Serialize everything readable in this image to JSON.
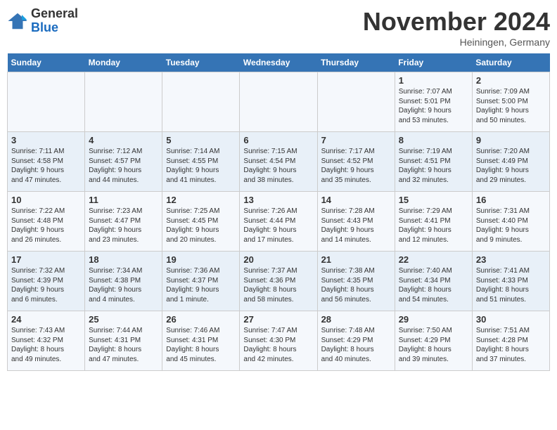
{
  "logo": {
    "general": "General",
    "blue": "Blue"
  },
  "title": "November 2024",
  "location": "Heiningen, Germany",
  "days_of_week": [
    "Sunday",
    "Monday",
    "Tuesday",
    "Wednesday",
    "Thursday",
    "Friday",
    "Saturday"
  ],
  "weeks": [
    [
      {
        "day": "",
        "info": ""
      },
      {
        "day": "",
        "info": ""
      },
      {
        "day": "",
        "info": ""
      },
      {
        "day": "",
        "info": ""
      },
      {
        "day": "",
        "info": ""
      },
      {
        "day": "1",
        "info": "Sunrise: 7:07 AM\nSunset: 5:01 PM\nDaylight: 9 hours\nand 53 minutes."
      },
      {
        "day": "2",
        "info": "Sunrise: 7:09 AM\nSunset: 5:00 PM\nDaylight: 9 hours\nand 50 minutes."
      }
    ],
    [
      {
        "day": "3",
        "info": "Sunrise: 7:11 AM\nSunset: 4:58 PM\nDaylight: 9 hours\nand 47 minutes."
      },
      {
        "day": "4",
        "info": "Sunrise: 7:12 AM\nSunset: 4:57 PM\nDaylight: 9 hours\nand 44 minutes."
      },
      {
        "day": "5",
        "info": "Sunrise: 7:14 AM\nSunset: 4:55 PM\nDaylight: 9 hours\nand 41 minutes."
      },
      {
        "day": "6",
        "info": "Sunrise: 7:15 AM\nSunset: 4:54 PM\nDaylight: 9 hours\nand 38 minutes."
      },
      {
        "day": "7",
        "info": "Sunrise: 7:17 AM\nSunset: 4:52 PM\nDaylight: 9 hours\nand 35 minutes."
      },
      {
        "day": "8",
        "info": "Sunrise: 7:19 AM\nSunset: 4:51 PM\nDaylight: 9 hours\nand 32 minutes."
      },
      {
        "day": "9",
        "info": "Sunrise: 7:20 AM\nSunset: 4:49 PM\nDaylight: 9 hours\nand 29 minutes."
      }
    ],
    [
      {
        "day": "10",
        "info": "Sunrise: 7:22 AM\nSunset: 4:48 PM\nDaylight: 9 hours\nand 26 minutes."
      },
      {
        "day": "11",
        "info": "Sunrise: 7:23 AM\nSunset: 4:47 PM\nDaylight: 9 hours\nand 23 minutes."
      },
      {
        "day": "12",
        "info": "Sunrise: 7:25 AM\nSunset: 4:45 PM\nDaylight: 9 hours\nand 20 minutes."
      },
      {
        "day": "13",
        "info": "Sunrise: 7:26 AM\nSunset: 4:44 PM\nDaylight: 9 hours\nand 17 minutes."
      },
      {
        "day": "14",
        "info": "Sunrise: 7:28 AM\nSunset: 4:43 PM\nDaylight: 9 hours\nand 14 minutes."
      },
      {
        "day": "15",
        "info": "Sunrise: 7:29 AM\nSunset: 4:41 PM\nDaylight: 9 hours\nand 12 minutes."
      },
      {
        "day": "16",
        "info": "Sunrise: 7:31 AM\nSunset: 4:40 PM\nDaylight: 9 hours\nand 9 minutes."
      }
    ],
    [
      {
        "day": "17",
        "info": "Sunrise: 7:32 AM\nSunset: 4:39 PM\nDaylight: 9 hours\nand 6 minutes."
      },
      {
        "day": "18",
        "info": "Sunrise: 7:34 AM\nSunset: 4:38 PM\nDaylight: 9 hours\nand 4 minutes."
      },
      {
        "day": "19",
        "info": "Sunrise: 7:36 AM\nSunset: 4:37 PM\nDaylight: 9 hours\nand 1 minute."
      },
      {
        "day": "20",
        "info": "Sunrise: 7:37 AM\nSunset: 4:36 PM\nDaylight: 8 hours\nand 58 minutes."
      },
      {
        "day": "21",
        "info": "Sunrise: 7:38 AM\nSunset: 4:35 PM\nDaylight: 8 hours\nand 56 minutes."
      },
      {
        "day": "22",
        "info": "Sunrise: 7:40 AM\nSunset: 4:34 PM\nDaylight: 8 hours\nand 54 minutes."
      },
      {
        "day": "23",
        "info": "Sunrise: 7:41 AM\nSunset: 4:33 PM\nDaylight: 8 hours\nand 51 minutes."
      }
    ],
    [
      {
        "day": "24",
        "info": "Sunrise: 7:43 AM\nSunset: 4:32 PM\nDaylight: 8 hours\nand 49 minutes."
      },
      {
        "day": "25",
        "info": "Sunrise: 7:44 AM\nSunset: 4:31 PM\nDaylight: 8 hours\nand 47 minutes."
      },
      {
        "day": "26",
        "info": "Sunrise: 7:46 AM\nSunset: 4:31 PM\nDaylight: 8 hours\nand 45 minutes."
      },
      {
        "day": "27",
        "info": "Sunrise: 7:47 AM\nSunset: 4:30 PM\nDaylight: 8 hours\nand 42 minutes."
      },
      {
        "day": "28",
        "info": "Sunrise: 7:48 AM\nSunset: 4:29 PM\nDaylight: 8 hours\nand 40 minutes."
      },
      {
        "day": "29",
        "info": "Sunrise: 7:50 AM\nSunset: 4:29 PM\nDaylight: 8 hours\nand 39 minutes."
      },
      {
        "day": "30",
        "info": "Sunrise: 7:51 AM\nSunset: 4:28 PM\nDaylight: 8 hours\nand 37 minutes."
      }
    ]
  ]
}
